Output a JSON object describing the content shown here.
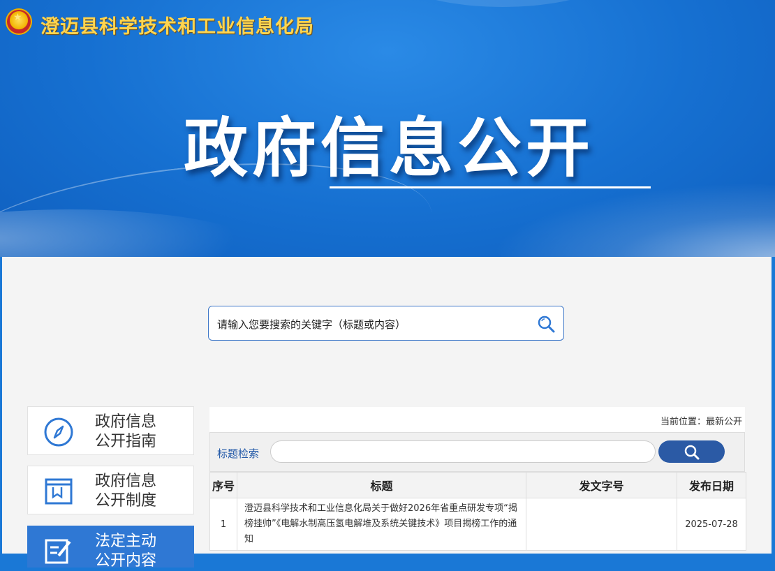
{
  "header": {
    "org_name": "澄迈县科学技术和工业信息化局",
    "banner_title": "政府信息公开"
  },
  "search": {
    "placeholder": "请输入您要搜索的关键字（标题或内容）"
  },
  "sidebar": {
    "items": [
      {
        "line1": "政府信息",
        "line2": "公开指南",
        "icon": "compass-icon"
      },
      {
        "line1": "政府信息",
        "line2": "公开制度",
        "icon": "book-icon"
      },
      {
        "line1": "法定主动",
        "line2": "公开内容",
        "icon": "edit-icon"
      }
    ]
  },
  "breadcrumb": "当前位置：最新公开",
  "filter": {
    "label": "标题检索",
    "value": ""
  },
  "table": {
    "headers": [
      "序号",
      "标题",
      "发文字号",
      "发布日期"
    ],
    "rows": [
      {
        "no": "1",
        "title": "澄迈县科学技术和工业信息化局关于做好2026年省重点研发专项“揭榜挂帅”《电解水制高压氢电解堆及系统关键技术》项目揭榜工作的通知",
        "doc_no": "",
        "date": "2025-07-28"
      }
    ]
  },
  "colors": {
    "brand_blue": "#1670d1",
    "title_gold": "#ffd54f",
    "active_blue": "#2f78d4",
    "button_blue": "#2b5aa5"
  }
}
